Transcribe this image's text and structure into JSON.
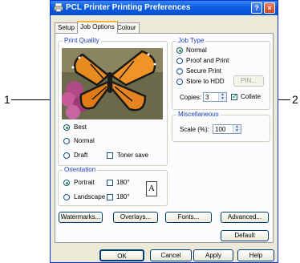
{
  "callouts": {
    "left": "1",
    "right": "2"
  },
  "window": {
    "title": "PCL Printer Printing Preferences",
    "help": "?",
    "close": "×"
  },
  "tabs": [
    {
      "label": "Setup"
    },
    {
      "label": "Job Options"
    },
    {
      "label": "Colour"
    }
  ],
  "print_quality": {
    "title": "Print Quality",
    "options": [
      {
        "label": "Best",
        "selected": true
      },
      {
        "label": "Normal",
        "selected": false
      },
      {
        "label": "Draft",
        "selected": false
      }
    ],
    "toner_save": {
      "label": "Toner save",
      "checked": false
    }
  },
  "job_type": {
    "title": "Job Type",
    "options": [
      {
        "label": "Normal",
        "selected": true
      },
      {
        "label": "Proof and Print",
        "selected": false
      },
      {
        "label": "Secure Print",
        "selected": false
      },
      {
        "label": "Store to HDD",
        "selected": false
      }
    ],
    "pin_button": "PIN...",
    "copies_label": "Copies:",
    "copies_value": "3",
    "collate": {
      "label": "Collate",
      "checked": true
    }
  },
  "miscellaneous": {
    "title": "Miscellaneous",
    "scale_label": "Scale (%):",
    "scale_value": "100"
  },
  "orientation": {
    "title": "Orientation",
    "portrait": {
      "label": "Portrait",
      "selected": true
    },
    "landscape": {
      "label": "Landscape",
      "selected": false
    },
    "rotate_1": {
      "label": "180°",
      "checked": false
    },
    "rotate_2": {
      "label": "180°",
      "checked": false
    },
    "preview_letter": "A"
  },
  "buttons": {
    "watermarks": "Watermarks...",
    "overlays": "Overlays...",
    "fonts": "Fonts...",
    "advanced": "Advanced...",
    "default": "Default",
    "ok": "OK",
    "cancel": "Cancel",
    "apply": "Apply",
    "help": "Help"
  }
}
